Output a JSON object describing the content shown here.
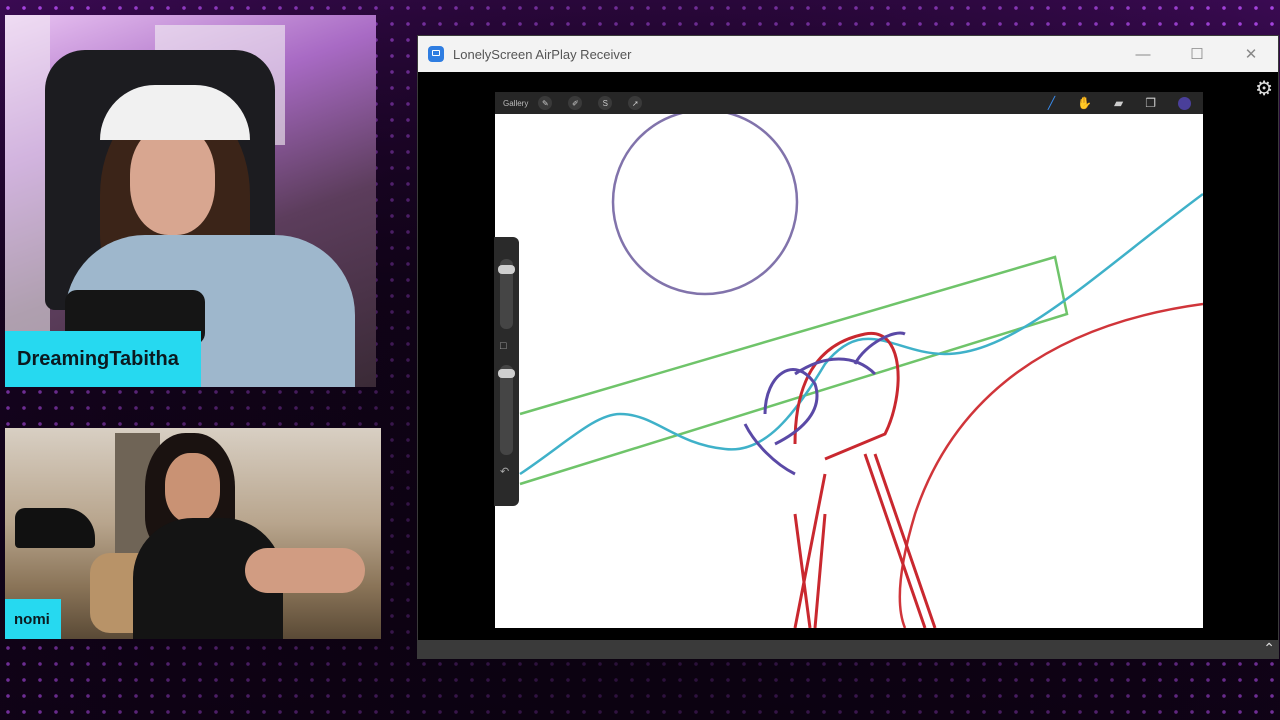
{
  "overlay": {
    "cam1_name": "DreamingTabitha",
    "cam2_name": "nomi"
  },
  "window": {
    "title": "LonelyScreen AirPlay Receiver",
    "minimize": "—",
    "maximize": "☐",
    "close": "✕",
    "settings_icon": "⚙"
  },
  "procreate": {
    "gallery_label": "Gallery",
    "left_tools": [
      "✎",
      "✐",
      "S",
      "➚"
    ],
    "right_tools": [
      "brush-icon",
      "smudge-icon",
      "eraser-icon",
      "layers-icon"
    ],
    "active_color": "#4a3f9a",
    "undo_icon": "↶",
    "modify_icon": "□"
  },
  "scroll_up_icon": "⌃"
}
